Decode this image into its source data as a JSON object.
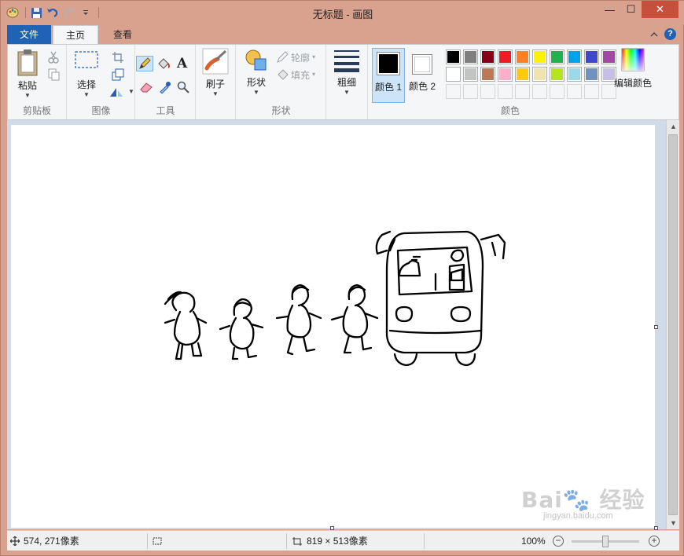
{
  "window": {
    "title": "无标题 - 画图",
    "minimize": "—",
    "maximize": "☐",
    "close": "✕"
  },
  "tabs": {
    "file": "文件",
    "home": "主页",
    "view": "查看",
    "help": "?"
  },
  "groups": {
    "clipboard": {
      "label": "剪贴板",
      "paste": "粘贴"
    },
    "image": {
      "label": "图像",
      "select": "选择"
    },
    "tools": {
      "label": "工具",
      "text_glyph": "A"
    },
    "brushes": {
      "brush": "刷子"
    },
    "shapes": {
      "label": "形状",
      "shapes_btn": "形状",
      "outline": "轮廓",
      "fill": "填充"
    },
    "size": {
      "label": "粗细"
    },
    "colors": {
      "label": "颜色",
      "color1": "颜色 1",
      "color2": "颜色 2",
      "edit": "编辑颜色",
      "color1_value": "#000000",
      "color2_value": "#ffffff",
      "palette_row1": [
        "#000000",
        "#7f7f7f",
        "#880015",
        "#ed1c24",
        "#ff7f27",
        "#fff200",
        "#22b14c",
        "#00a2e8",
        "#3f48cc",
        "#a349a4"
      ],
      "palette_row2": [
        "#ffffff",
        "#c3c3c3",
        "#b97a57",
        "#ffaec9",
        "#ffc90e",
        "#efe4b0",
        "#b5e61d",
        "#99d9ea",
        "#7092be",
        "#c8bfe7"
      ]
    }
  },
  "status": {
    "cursor_pos": "574, 271像素",
    "canvas_size": "819 × 513像素",
    "zoom": "100%",
    "zoom_out": "−",
    "zoom_in": "+"
  },
  "watermark": {
    "text": "Bai 经验",
    "url": "jingyan.baidu.com"
  }
}
